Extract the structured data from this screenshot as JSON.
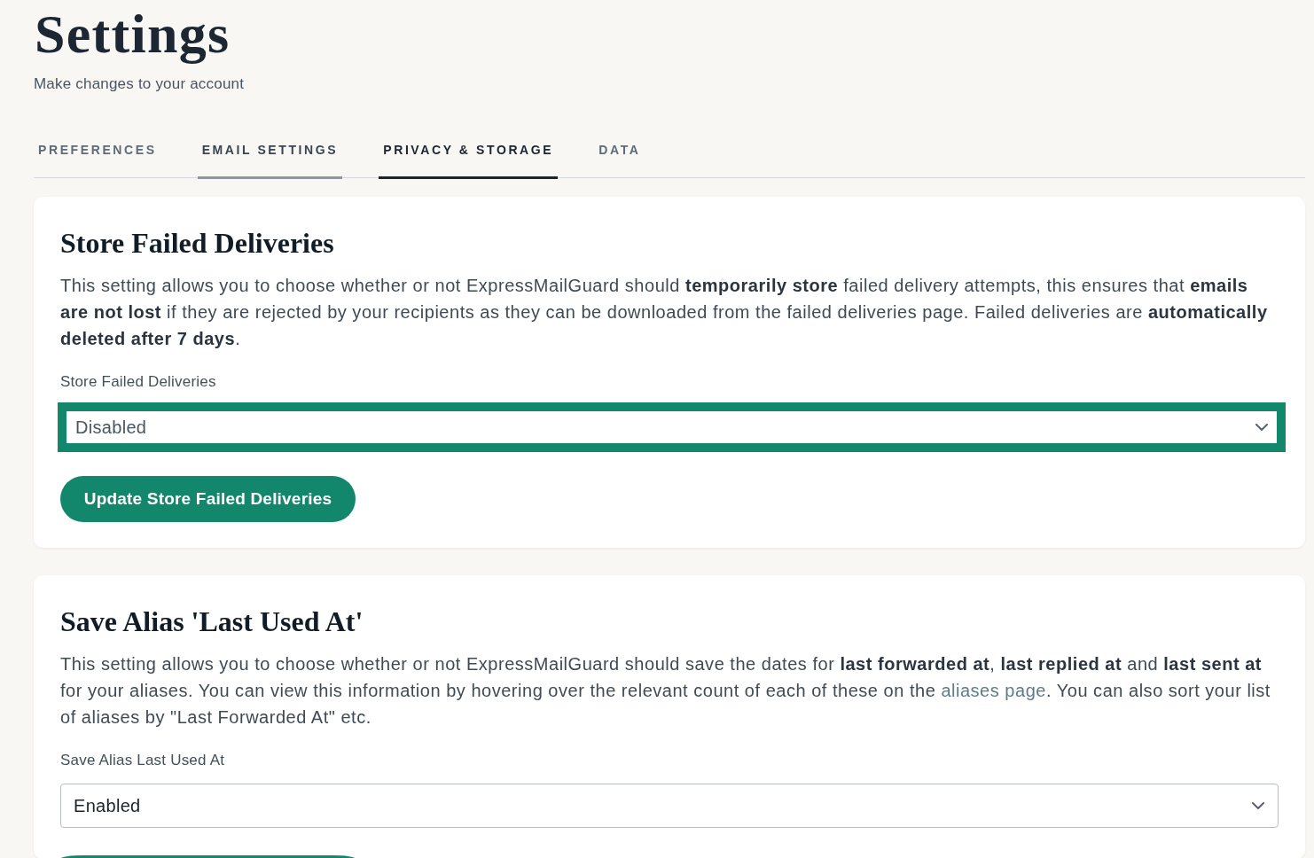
{
  "page": {
    "title": "Settings",
    "subtitle": "Make changes to your account"
  },
  "tabs": [
    {
      "label": "PREFERENCES",
      "selected": false,
      "hovered": false
    },
    {
      "label": "EMAIL SETTINGS",
      "selected": false,
      "hovered": true
    },
    {
      "label": "PRIVACY & STORAGE",
      "selected": true,
      "hovered": false
    },
    {
      "label": "DATA",
      "selected": false,
      "hovered": false
    }
  ],
  "sections": [
    {
      "title": "Store Failed Deliveries",
      "description": [
        {
          "kind": "text",
          "text": "This setting allows you to choose whether or not ExpressMailGuard should **temporarily store** failed delivery attempts, this ensures that **emails are not lost** if they are rejected by your recipients as they can be downloaded from the failed deliveries page. Failed deliveries are **automatically deleted after 7 days**."
        }
      ],
      "field_label": "Store Failed Deliveries",
      "select": {
        "value": "Disabled",
        "focused": true
      },
      "button": {
        "label": "Update Store Failed Deliveries",
        "cut_off": false
      }
    },
    {
      "title": "Save Alias 'Last Used At'",
      "description": [
        {
          "kind": "text",
          "text": "This setting allows you to choose whether or not ExpressMailGuard should save the dates for **last forwarded at**, **last replied at** and **last sent at** for your aliases. You can view this information by hovering over the relevant count of each of these on the "
        },
        {
          "kind": "link",
          "text": "aliases page"
        },
        {
          "kind": "text",
          "text": ". You can also sort your list of aliases by \"Last Forwarded At\" etc."
        }
      ],
      "field_label": "Save Alias Last Used At",
      "select": {
        "value": "Enabled",
        "focused": false
      },
      "button": {
        "cut_off": true
      }
    }
  ]
}
